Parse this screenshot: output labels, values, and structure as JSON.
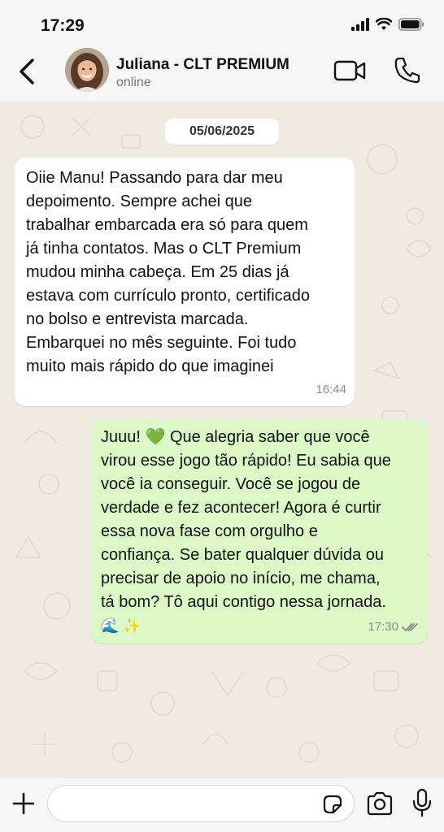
{
  "status_bar": {
    "time": "17:29"
  },
  "header": {
    "contact_name": "Juliana - CLT PREMIUM",
    "contact_status": "online"
  },
  "chat": {
    "date_chip": "05/06/2025",
    "messages": [
      {
        "direction": "incoming",
        "text": "Oiie Manu! Passando para dar meu\ndepoimento. Sempre achei que\ntrabalhar embarcada era só para quem\njá tinha contatos. Mas o CLT Premium\nmudou minha cabeça. Em 25 dias já\nestava com currículo pronto, certificado\nno bolso e entrevista marcada.\nEmbarquei no mês seguinte. Foi tudo\nmuito mais rápido do que imaginei",
        "time": "16:44"
      },
      {
        "direction": "outgoing",
        "text": "Juuu! 💚  Que alegria saber que você\nvirou esse jogo tão rápido! Eu sabia que\nvocê ia conseguir. Você se jogou de\nverdade e fez acontecer! Agora é curtir\nessa nova fase com orgulho e\nconfiança. Se bater qualquer dúvida ou\nprecisar de apoio no início, me chama,\ntá bom? Tô aqui contigo nessa jornada.",
        "emojis": "🌊 ✨",
        "time": "17:30",
        "read_status": "double-check-read"
      }
    ]
  },
  "composer": {
    "input_value": "",
    "input_placeholder": ""
  },
  "colors": {
    "incoming_bubble": "#ffffff",
    "outgoing_bubble": "#dcf8c6",
    "chat_background": "#efeae2",
    "read_check": "#8a8a8a"
  },
  "icons": [
    "back-icon",
    "video-call-icon",
    "phone-icon",
    "plus-icon",
    "sticker-icon",
    "camera-icon",
    "mic-icon",
    "signal-icon",
    "wifi-icon",
    "battery-icon",
    "double-check-icon"
  ]
}
